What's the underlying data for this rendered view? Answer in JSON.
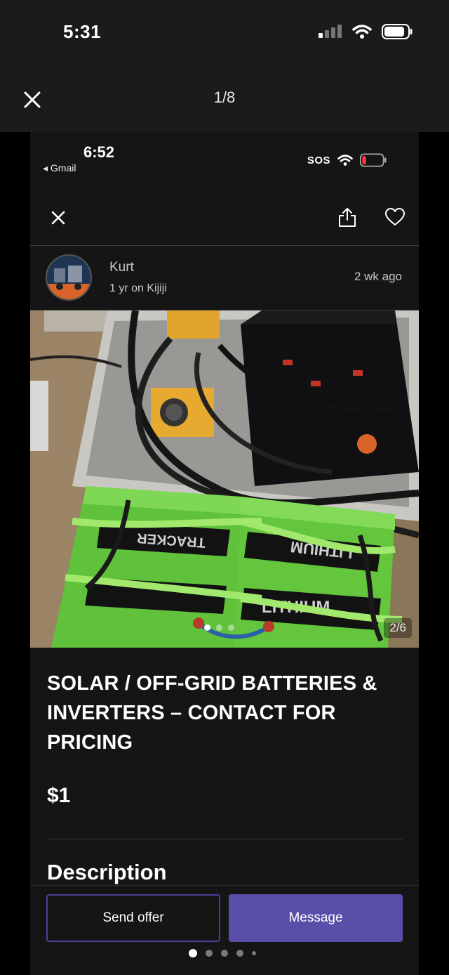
{
  "outer": {
    "time": "5:31",
    "counter": "1/8"
  },
  "inner_status": {
    "time": "6:52",
    "back_app": "◂ Gmail",
    "sos": "SOS"
  },
  "seller": {
    "name": "Kurt",
    "tenure": "1 yr on Kijiji",
    "posted": "2 wk  ago"
  },
  "photo": {
    "counter": "2/6",
    "dot_count": 3,
    "active_dot": 1
  },
  "listing": {
    "title": " SOLAR / OFF-GRID BATTERIES & INVERTERS – CONTACT FOR PRICING",
    "price": "$1",
    "description_heading": "Description"
  },
  "actions": {
    "offer_label": "Send offer",
    "message_label": "Message"
  },
  "colors": {
    "accent": "#5a4fa8",
    "offer_border": "#4b3f9a",
    "background": "#151516"
  },
  "icons": [
    "close-icon",
    "share-icon",
    "heart-icon",
    "wifi-icon",
    "battery-icon",
    "signal-icon"
  ],
  "photo_text": [
    "TRACKER",
    "LITHIUM"
  ]
}
